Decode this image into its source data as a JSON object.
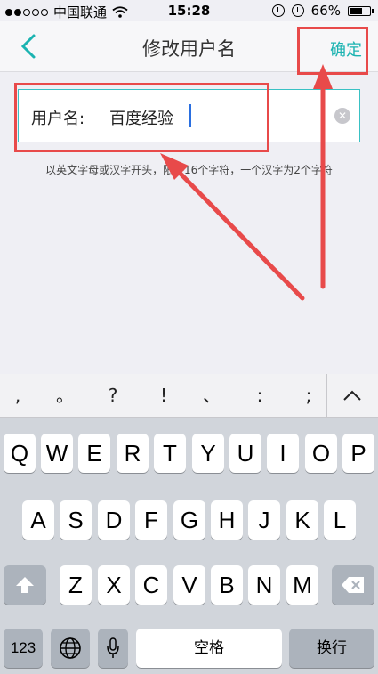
{
  "status_bar": {
    "carrier": "中国联通",
    "time": "15:28",
    "battery": "66%",
    "battery_level": 0.66
  },
  "nav": {
    "title": "修改用户名",
    "confirm_label": "确定",
    "back_icon": "chevron-left-icon"
  },
  "username_field": {
    "label": "用户名:",
    "value": "百度经验",
    "clear_icon": "clear-circle-icon"
  },
  "hint": "以英文字母或汉字开头，限4-16个字符，一个汉字为2个字符",
  "keyboard": {
    "punctuation": [
      ",",
      "。",
      "?",
      "!",
      "、",
      ":",
      ";"
    ],
    "row1": [
      "Q",
      "W",
      "E",
      "R",
      "T",
      "Y",
      "U",
      "I",
      "O",
      "P"
    ],
    "row2": [
      "A",
      "S",
      "D",
      "F",
      "G",
      "H",
      "J",
      "K",
      "L"
    ],
    "row3": [
      "Z",
      "X",
      "C",
      "V",
      "B",
      "N",
      "M"
    ],
    "numbers_label": "123",
    "space_label": "空格",
    "return_label": "换行"
  },
  "colors": {
    "accent": "#1bb3b1",
    "annotation": "#e84a4a"
  }
}
